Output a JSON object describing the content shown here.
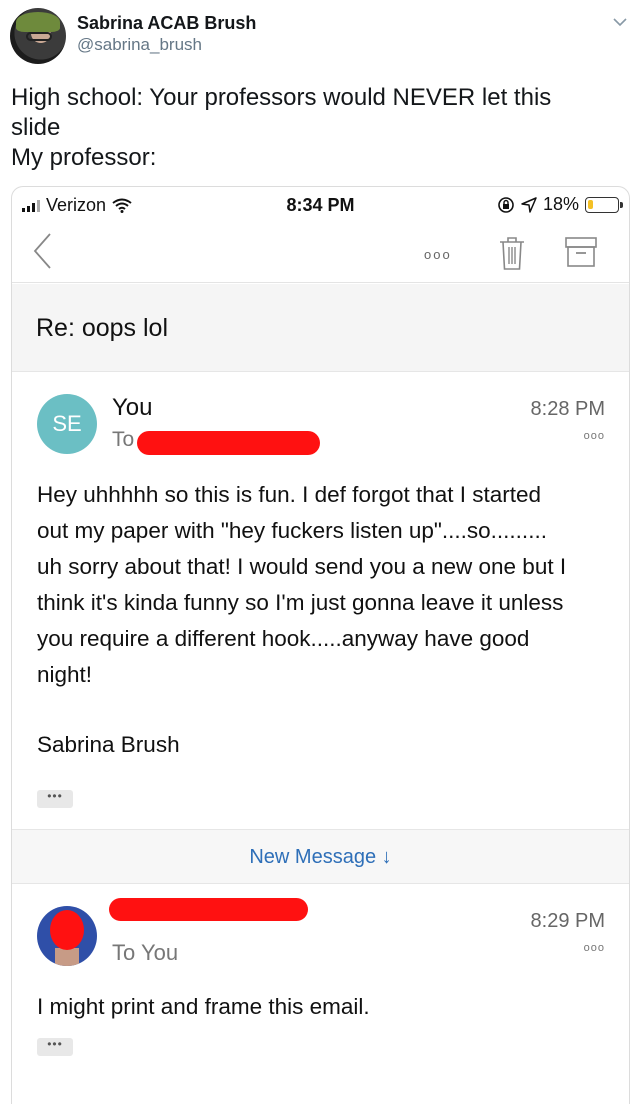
{
  "tweet": {
    "display_name": "Sabrina ACAB Brush",
    "handle": "@sabrina_brush",
    "text_lines": [
      "High school: Your professors would NEVER let this",
      "slide",
      "My professor:"
    ]
  },
  "status_bar": {
    "carrier": "Verizon",
    "time": "8:34 PM",
    "battery": "18%",
    "battery_level": 0.18
  },
  "email": {
    "subject": "Re: oops lol",
    "message1": {
      "avatar_initials": "SE",
      "sender": "You",
      "to_label": "To",
      "time": "8:28 PM",
      "body_lines": [
        "Hey uhhhhh so this is fun. I def forgot that I started",
        "out my paper with \"hey fuckers listen up\"....so.........",
        "uh sorry about that! I would send you a new one but I",
        "think it's kinda funny so I'm just gonna leave it unless",
        "you require a different hook.....anyway have good",
        "night!"
      ],
      "signature": "Sabrina Brush",
      "more_chip": "•••"
    },
    "new_message": "New Message ↓",
    "message2": {
      "to_label": "To You",
      "time": "8:29 PM",
      "body": "I might print and frame this email.",
      "more_chip": "•••"
    },
    "more_dots": "ooo"
  },
  "icons": [
    "chevron-down-icon",
    "signal-icon",
    "wifi-icon",
    "lock-rotation-icon",
    "location-icon",
    "battery-icon",
    "back-icon",
    "more-icon",
    "trash-icon",
    "archive-icon"
  ],
  "colors": {
    "accent": "#2e6fb8",
    "avatar_se": "#6bbfc4",
    "redaction": "#ff1111",
    "battery": "#f4c025"
  }
}
